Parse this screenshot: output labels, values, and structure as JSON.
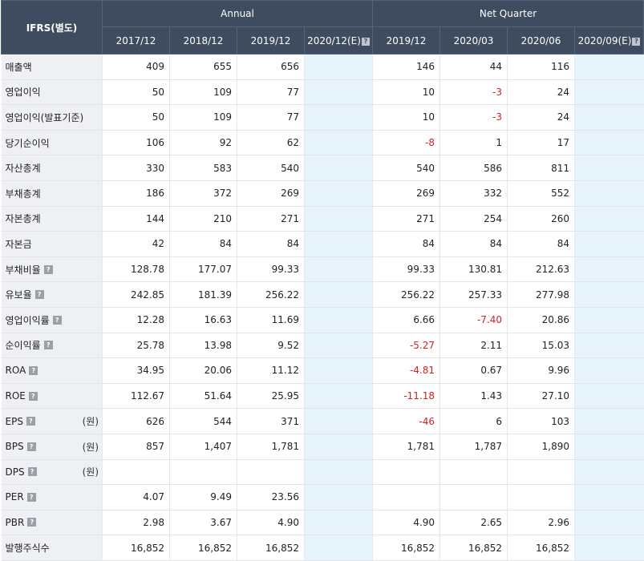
{
  "header": {
    "corner": "IFRS(별도)",
    "annual_label": "Annual",
    "quarter_label": "Net Quarter",
    "annual_periods": [
      "2017/12",
      "2018/12",
      "2019/12",
      "2020/12(E)"
    ],
    "quarter_periods": [
      "2019/12",
      "2020/03",
      "2020/06",
      "2020/09(E)"
    ]
  },
  "help_icon_glyph": "?",
  "colors": {
    "header_bg": "#3f4b5e",
    "label_bg": "#eef0f3",
    "estimate_bg": "#e8f4fb",
    "negative": "#d62020"
  },
  "rows": [
    {
      "label": "매출액",
      "help": false,
      "unit": "",
      "values": [
        "409",
        "655",
        "656",
        "",
        "146",
        "44",
        "116",
        ""
      ]
    },
    {
      "label": "영업이익",
      "help": false,
      "unit": "",
      "values": [
        "50",
        "109",
        "77",
        "",
        "10",
        "-3",
        "24",
        ""
      ]
    },
    {
      "label": "영업이익(발표기준)",
      "help": false,
      "unit": "",
      "values": [
        "50",
        "109",
        "77",
        "",
        "10",
        "-3",
        "24",
        ""
      ]
    },
    {
      "label": "당기순이익",
      "help": false,
      "unit": "",
      "values": [
        "106",
        "92",
        "62",
        "",
        "-8",
        "1",
        "17",
        ""
      ]
    },
    {
      "label": "자산총계",
      "help": false,
      "unit": "",
      "values": [
        "330",
        "583",
        "540",
        "",
        "540",
        "586",
        "811",
        ""
      ]
    },
    {
      "label": "부채총계",
      "help": false,
      "unit": "",
      "values": [
        "186",
        "372",
        "269",
        "",
        "269",
        "332",
        "552",
        ""
      ]
    },
    {
      "label": "자본총계",
      "help": false,
      "unit": "",
      "values": [
        "144",
        "210",
        "271",
        "",
        "271",
        "254",
        "260",
        ""
      ]
    },
    {
      "label": "자본금",
      "help": false,
      "unit": "",
      "values": [
        "42",
        "84",
        "84",
        "",
        "84",
        "84",
        "84",
        ""
      ]
    },
    {
      "label": "부채비율",
      "help": true,
      "unit": "",
      "values": [
        "128.78",
        "177.07",
        "99.33",
        "",
        "99.33",
        "130.81",
        "212.63",
        ""
      ]
    },
    {
      "label": "유보율",
      "help": true,
      "unit": "",
      "values": [
        "242.85",
        "181.39",
        "256.22",
        "",
        "256.22",
        "257.33",
        "277.98",
        ""
      ]
    },
    {
      "label": "영업이익률",
      "help": true,
      "unit": "",
      "values": [
        "12.28",
        "16.63",
        "11.69",
        "",
        "6.66",
        "-7.40",
        "20.86",
        ""
      ]
    },
    {
      "label": "순이익률",
      "help": true,
      "unit": "",
      "values": [
        "25.78",
        "13.98",
        "9.52",
        "",
        "-5.27",
        "2.11",
        "15.03",
        ""
      ]
    },
    {
      "label": "ROA",
      "help": true,
      "unit": "",
      "values": [
        "34.95",
        "20.06",
        "11.12",
        "",
        "-4.81",
        "0.67",
        "9.96",
        ""
      ]
    },
    {
      "label": "ROE",
      "help": true,
      "unit": "",
      "values": [
        "112.67",
        "51.64",
        "25.95",
        "",
        "-11.18",
        "1.43",
        "27.10",
        ""
      ]
    },
    {
      "label": "EPS",
      "help": true,
      "unit": "(원)",
      "values": [
        "626",
        "544",
        "371",
        "",
        "-46",
        "6",
        "103",
        ""
      ]
    },
    {
      "label": "BPS",
      "help": true,
      "unit": "(원)",
      "values": [
        "857",
        "1,407",
        "1,781",
        "",
        "1,781",
        "1,787",
        "1,890",
        ""
      ]
    },
    {
      "label": "DPS",
      "help": true,
      "unit": "(원)",
      "values": [
        "",
        "",
        "",
        "",
        "",
        "",
        "",
        ""
      ]
    },
    {
      "label": "PER",
      "help": true,
      "unit": "",
      "values": [
        "4.07",
        "9.49",
        "23.56",
        "",
        "",
        "",
        "",
        ""
      ]
    },
    {
      "label": "PBR",
      "help": true,
      "unit": "",
      "values": [
        "2.98",
        "3.67",
        "4.90",
        "",
        "4.90",
        "2.65",
        "2.96",
        ""
      ]
    },
    {
      "label": "발행주식수",
      "help": false,
      "unit": "",
      "values": [
        "16,852",
        "16,852",
        "16,852",
        "",
        "16,852",
        "16,852",
        "16,852",
        ""
      ]
    }
  ]
}
